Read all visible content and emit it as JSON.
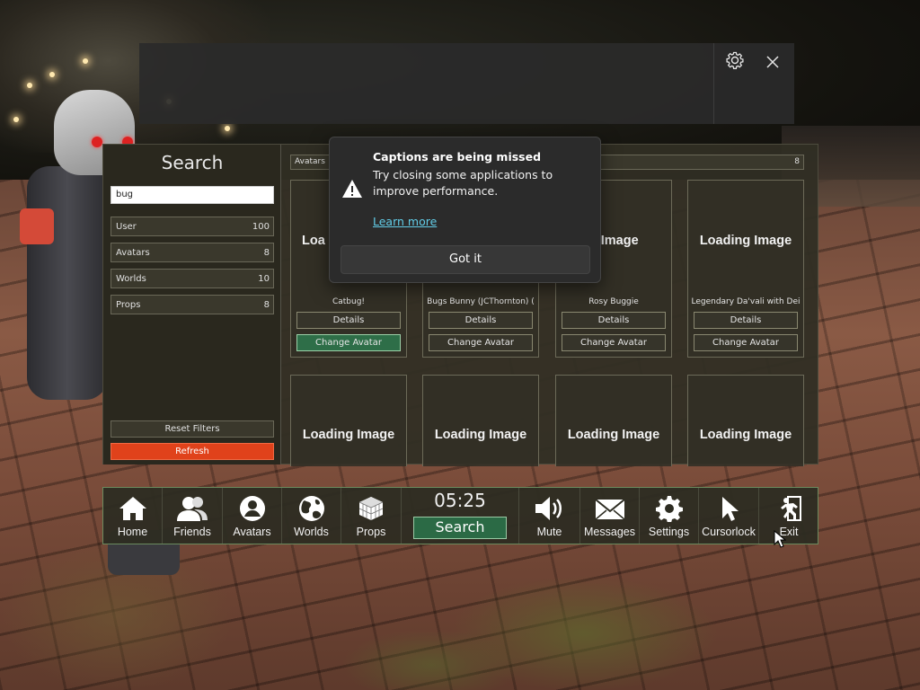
{
  "captions": {
    "settings_icon": "gear-icon",
    "close_icon": "close-icon"
  },
  "toast": {
    "title": "Captions are being missed",
    "body": "Try closing some applications to improve performance.",
    "link": "Learn more",
    "button": "Got it",
    "icon": "warning-icon"
  },
  "search_panel": {
    "title": "Search",
    "query": "bug",
    "filters": [
      {
        "label": "User",
        "count": "100"
      },
      {
        "label": "Avatars",
        "count": "8"
      },
      {
        "label": "Worlds",
        "count": "10"
      },
      {
        "label": "Props",
        "count": "8"
      }
    ],
    "reset_label": "Reset Filters",
    "refresh_label": "Refresh"
  },
  "results": {
    "category_label": "Avatars",
    "category_count": "8",
    "loading_text": "Loading Image",
    "loading_text_partial_1": "Loa",
    "loading_text_partial_3": "ng Image",
    "details_label": "Details",
    "change_label": "Change Avatar",
    "items": [
      {
        "name": "Catbug!"
      },
      {
        "name": "Bugs Bunny (JCThornton) ("
      },
      {
        "name": "Rosy Buggie"
      },
      {
        "name": "Legendary Da'vali with Dei"
      }
    ]
  },
  "toolbar": {
    "home": "Home",
    "friends": "Friends",
    "avatars": "Avatars",
    "worlds": "Worlds",
    "props": "Props",
    "time": "05:25",
    "search": "Search",
    "mute": "Mute",
    "messages": "Messages",
    "settings": "Settings",
    "cursorlock": "Cursorlock",
    "exit": "Exit"
  },
  "colors": {
    "refresh": "#e0421b",
    "selected_button": "#2e6e48",
    "link": "#62cde8"
  }
}
